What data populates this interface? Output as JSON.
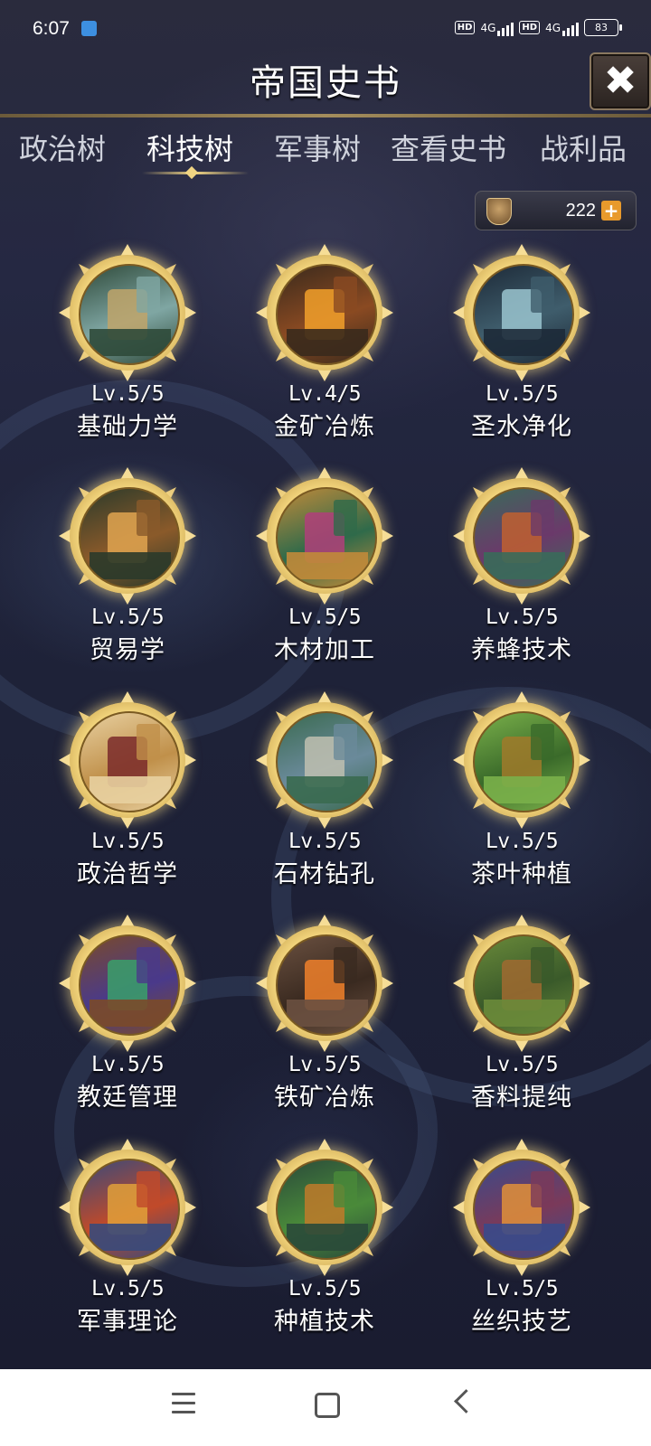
{
  "status_bar": {
    "time": "6:07",
    "hd_label": "HD",
    "network": "4G",
    "battery": "83"
  },
  "header": {
    "title": "帝国史书",
    "close_icon": "close-x-icon"
  },
  "tabs": [
    {
      "label": "政治树",
      "active": false
    },
    {
      "label": "科技树",
      "active": true
    },
    {
      "label": "军事树",
      "active": false
    },
    {
      "label": "查看史书",
      "active": false
    },
    {
      "label": "战利品",
      "active": false
    }
  ],
  "currency": {
    "icon": "emblem-icon",
    "amount": "222",
    "plus_label": "+"
  },
  "techs": [
    {
      "level": "Lv.5/5",
      "name": "基础力学",
      "colors": [
        "#7fa6a3",
        "#c0a46a",
        "#2f4a3a"
      ]
    },
    {
      "level": "Lv.4/5",
      "name": "金矿冶炼",
      "colors": [
        "#8a4a22",
        "#f2a02a",
        "#3a2a1c"
      ]
    },
    {
      "level": "Lv.5/5",
      "name": "圣水净化",
      "colors": [
        "#3f5d6c",
        "#9ac4cf",
        "#1d2a38"
      ]
    },
    {
      "level": "Lv.5/5",
      "name": "贸易学",
      "colors": [
        "#8a5a2a",
        "#e0a450",
        "#2b3a2a"
      ]
    },
    {
      "level": "Lv.5/5",
      "name": "木材加工",
      "colors": [
        "#2f6a4a",
        "#b0407a",
        "#c08a3a"
      ]
    },
    {
      "level": "Lv.5/5",
      "name": "养蜂技术",
      "colors": [
        "#6a3a6a",
        "#c06030",
        "#3a6a5a"
      ]
    },
    {
      "level": "Lv.5/5",
      "name": "政治哲学",
      "colors": [
        "#c0904a",
        "#7a2a2a",
        "#e8d0a0"
      ]
    },
    {
      "level": "Lv.5/5",
      "name": "石材钻孔",
      "colors": [
        "#6a8a9a",
        "#c0c0b0",
        "#3a6a50"
      ]
    },
    {
      "level": "Lv.5/5",
      "name": "茶叶种植",
      "colors": [
        "#3a6a2a",
        "#a07a2a",
        "#7ab04a"
      ]
    },
    {
      "level": "Lv.5/5",
      "name": "教廷管理",
      "colors": [
        "#4a3a8a",
        "#3aa06a",
        "#7a4a2a"
      ]
    },
    {
      "level": "Lv.5/5",
      "name": "铁矿冶炼",
      "colors": [
        "#3a2a20",
        "#f0802a",
        "#6a5040"
      ]
    },
    {
      "level": "Lv.5/5",
      "name": "香料提纯",
      "colors": [
        "#3a5a2a",
        "#a06a30",
        "#6a8a3a"
      ]
    },
    {
      "level": "Lv.5/5",
      "name": "军事理论",
      "colors": [
        "#c04a2a",
        "#e0a03a",
        "#3a4a7a"
      ]
    },
    {
      "level": "Lv.5/5",
      "name": "种植技术",
      "colors": [
        "#4a8a3a",
        "#c07a2a",
        "#2a4a3a"
      ]
    },
    {
      "level": "Lv.5/5",
      "name": "丝织技艺",
      "colors": [
        "#7a3a5a",
        "#e0903a",
        "#3a4a8a"
      ]
    }
  ],
  "nav_bar": {
    "menu_icon": "menu-icon",
    "home_icon": "home-square-icon",
    "back_icon": "back-chevron-icon"
  }
}
